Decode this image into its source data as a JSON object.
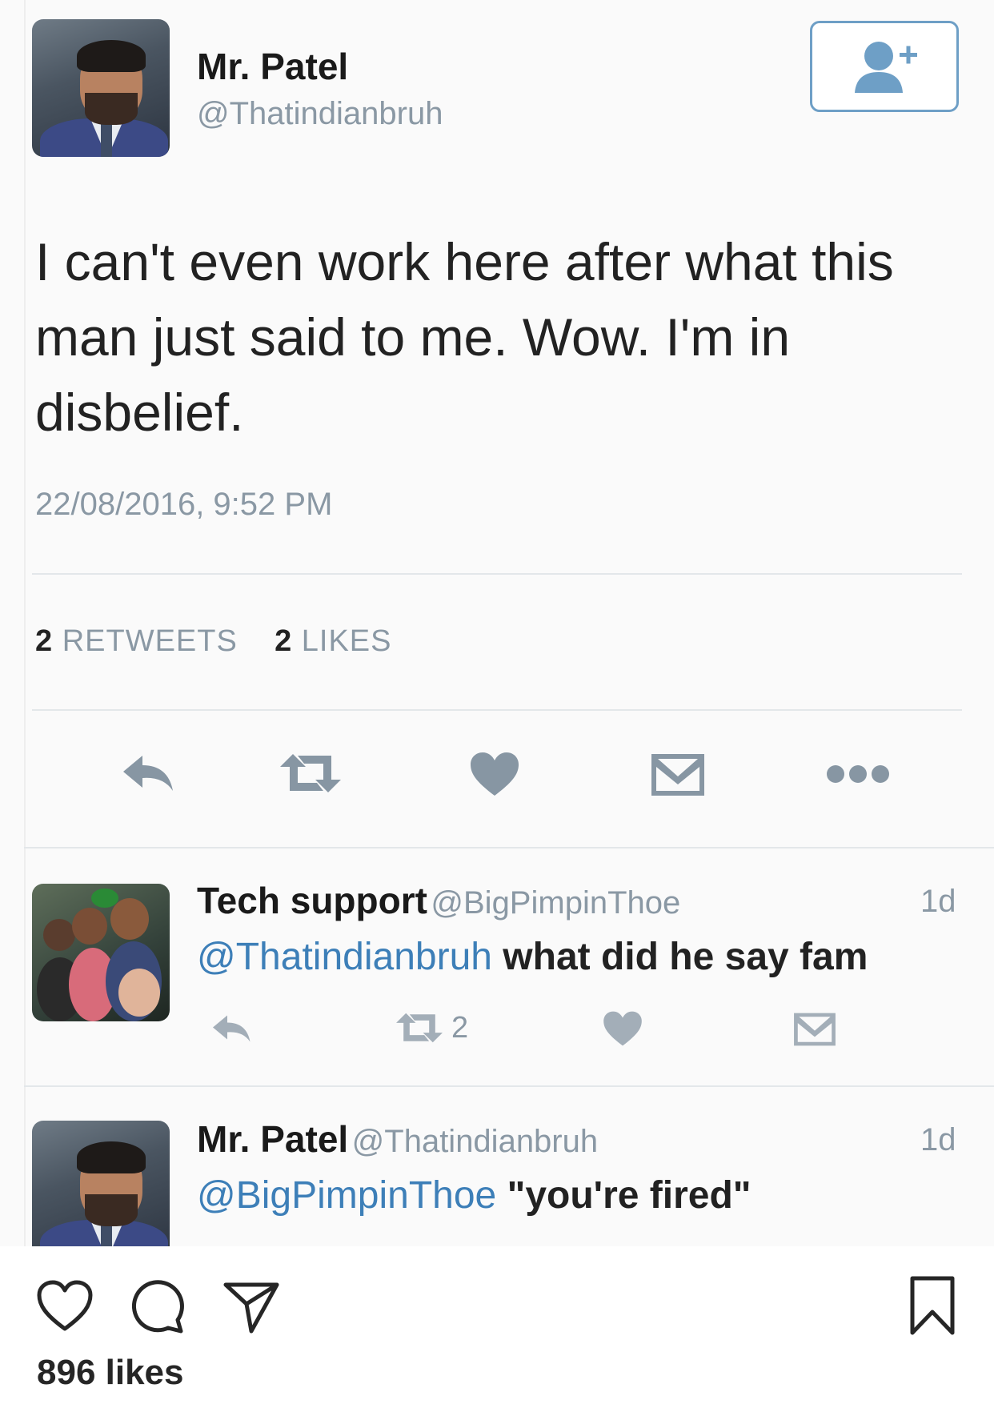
{
  "tweet": {
    "author_name": "Mr. Patel",
    "author_handle": "@Thatindianbruh",
    "text": "I can't even work here after what this man just said to me. Wow. I'm in disbelief.",
    "timestamp": "22/08/2016, 9:52 PM",
    "retweets_count": "2",
    "retweets_label": "RETWEETS",
    "likes_count": "2",
    "likes_label": "LIKES",
    "actions": [
      "reply-icon",
      "retweet-icon",
      "heart-icon",
      "direct-message-icon",
      "more-icon"
    ],
    "follow_icon": "add-user-icon"
  },
  "replies": [
    {
      "name": "Tech support",
      "handle": "@BigPimpinThoe",
      "age": "1d",
      "mention": "@Thatindianbruh",
      "text": " what did he say fam",
      "retweet_count": "2"
    },
    {
      "name": "Mr. Patel",
      "handle": "@Thatindianbruh",
      "age": "1d",
      "mention": "@BigPimpinThoe",
      "text": " \"you're fired\""
    }
  ],
  "instagram": {
    "actions": [
      "heart-icon",
      "comment-icon",
      "share-icon",
      "bookmark-icon"
    ],
    "likes_text": "896 likes"
  },
  "colors": {
    "link": "#3d7fb8",
    "muted": "#8a98a4",
    "icon": "#8796a3",
    "follow_border": "#6e9fc6"
  }
}
